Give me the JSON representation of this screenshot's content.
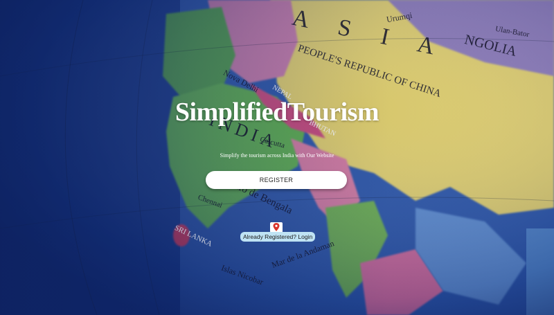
{
  "hero": {
    "title": "SimplifiedTourism",
    "subtitle": "Simplify the tourism across India with Our Website",
    "register_label": "REGISTER",
    "login_label": "Already Registered? Login"
  },
  "background_map_labels": {
    "asia": "A S I A",
    "china": "PEOPLE'S REPUBLIC OF CHINA",
    "mongolia": "NGOLIA",
    "india": "INDIA",
    "nepal": "NEPAL",
    "bhutan": "BHUTAN",
    "delhi": "Nova Delhi",
    "calcutta": "Calcutta",
    "chennai": "Chennai",
    "bengala": "Golfo de Bengala",
    "srilanka": "SRI LANKA",
    "andaman": "Mar de la Andaman",
    "nicobar": "Islas Nicobar",
    "urumqi": "Urumqi",
    "ulan": "Ulan-Bator"
  },
  "colors": {
    "ocean": "#3f6fb8",
    "land_green": "#5aa84a",
    "land_yellow": "#e4d26a",
    "land_pink": "#d98aa8",
    "login_bg": "#bfe3f4",
    "pin_red": "#d9342b"
  },
  "icons": {
    "pin": "map-pin-icon"
  }
}
